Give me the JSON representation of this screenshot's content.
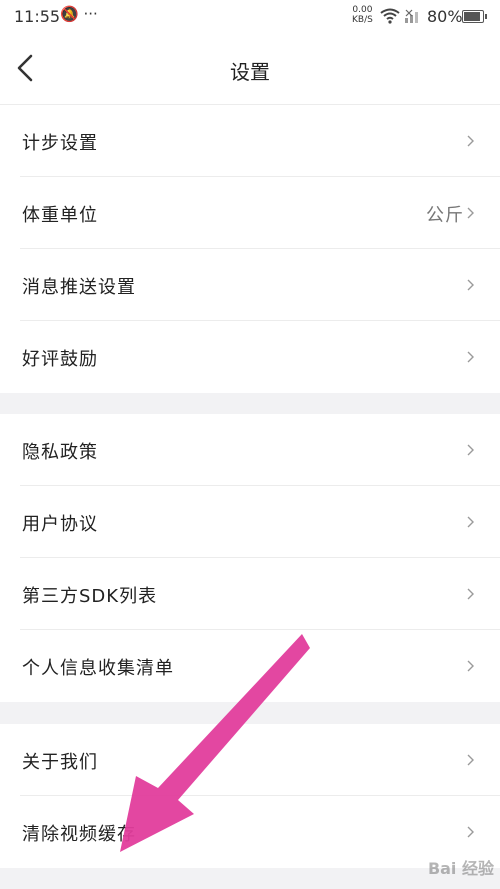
{
  "status_bar": {
    "time": "11:55",
    "left_icons": "🔕 ···",
    "speed_value": "0.00",
    "speed_unit": "KB/S",
    "battery_text": "80%",
    "battery_level": 0.8
  },
  "header": {
    "title": "设置"
  },
  "groups": [
    {
      "items": [
        {
          "label": "计步设置"
        },
        {
          "label": "体重单位",
          "value": "公斤"
        },
        {
          "label": "消息推送设置"
        },
        {
          "label": "好评鼓励"
        }
      ]
    },
    {
      "items": [
        {
          "label": "隐私政策"
        },
        {
          "label": "用户协议"
        },
        {
          "label": "第三方SDK列表"
        },
        {
          "label": "个人信息收集清单"
        }
      ]
    },
    {
      "items": [
        {
          "label": "关于我们"
        },
        {
          "label": "清除视频缓存"
        }
      ]
    }
  ],
  "annotation": {
    "arrow_color": "#e23d9c"
  },
  "watermark": {
    "text": "Bai 经验"
  },
  "colors": {
    "background": "#f2f2f4",
    "row": "#ffffff",
    "divider": "#ececec",
    "text": "#222222",
    "chevron": "#9a9a9a"
  }
}
